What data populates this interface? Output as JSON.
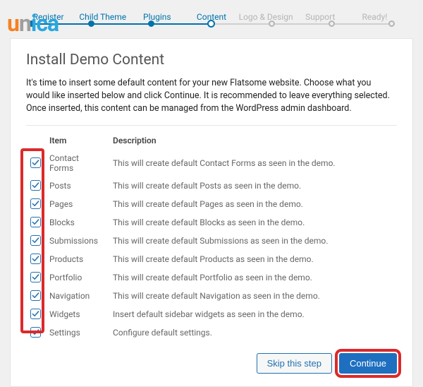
{
  "steps": {
    "items": [
      {
        "label": "Register",
        "state": "done"
      },
      {
        "label": "Child Theme",
        "state": "done"
      },
      {
        "label": "Plugins",
        "state": "done"
      },
      {
        "label": "Content",
        "state": "current"
      },
      {
        "label": "Logo & Design",
        "state": "future"
      },
      {
        "label": "Support",
        "state": "future"
      },
      {
        "label": "Ready!",
        "state": "future"
      }
    ]
  },
  "logo": {
    "text": "unica"
  },
  "page": {
    "title": "Install Demo Content",
    "intro": "It's time to insert some default content for your new Flatsome website. Choose what you would like inserted below and click Continue. It is recommended to leave everything selected. Once inserted, this content can be managed from the WordPress admin dashboard."
  },
  "table": {
    "headers": {
      "item": "Item",
      "description": "Description"
    },
    "rows": [
      {
        "checked": true,
        "name": "Contact Forms",
        "desc": "This will create default Contact Forms as seen in the demo."
      },
      {
        "checked": true,
        "name": "Posts",
        "desc": "This will create default Posts as seen in the demo."
      },
      {
        "checked": true,
        "name": "Pages",
        "desc": "This will create default Pages as seen in the demo."
      },
      {
        "checked": true,
        "name": "Blocks",
        "desc": "This will create default Blocks as seen in the demo."
      },
      {
        "checked": true,
        "name": "Submissions",
        "desc": "This will create default Submissions as seen in the demo."
      },
      {
        "checked": true,
        "name": "Products",
        "desc": "This will create default Products as seen in the demo."
      },
      {
        "checked": true,
        "name": "Portfolio",
        "desc": "This will create default Portfolio as seen in the demo."
      },
      {
        "checked": true,
        "name": "Navigation",
        "desc": "This will create default Navigation as seen in the demo."
      },
      {
        "checked": true,
        "name": "Widgets",
        "desc": "Insert default sidebar widgets as seen in the demo."
      },
      {
        "checked": true,
        "name": "Settings",
        "desc": "Configure default settings."
      }
    ]
  },
  "buttons": {
    "skip": "Skip this step",
    "continue": "Continue"
  }
}
